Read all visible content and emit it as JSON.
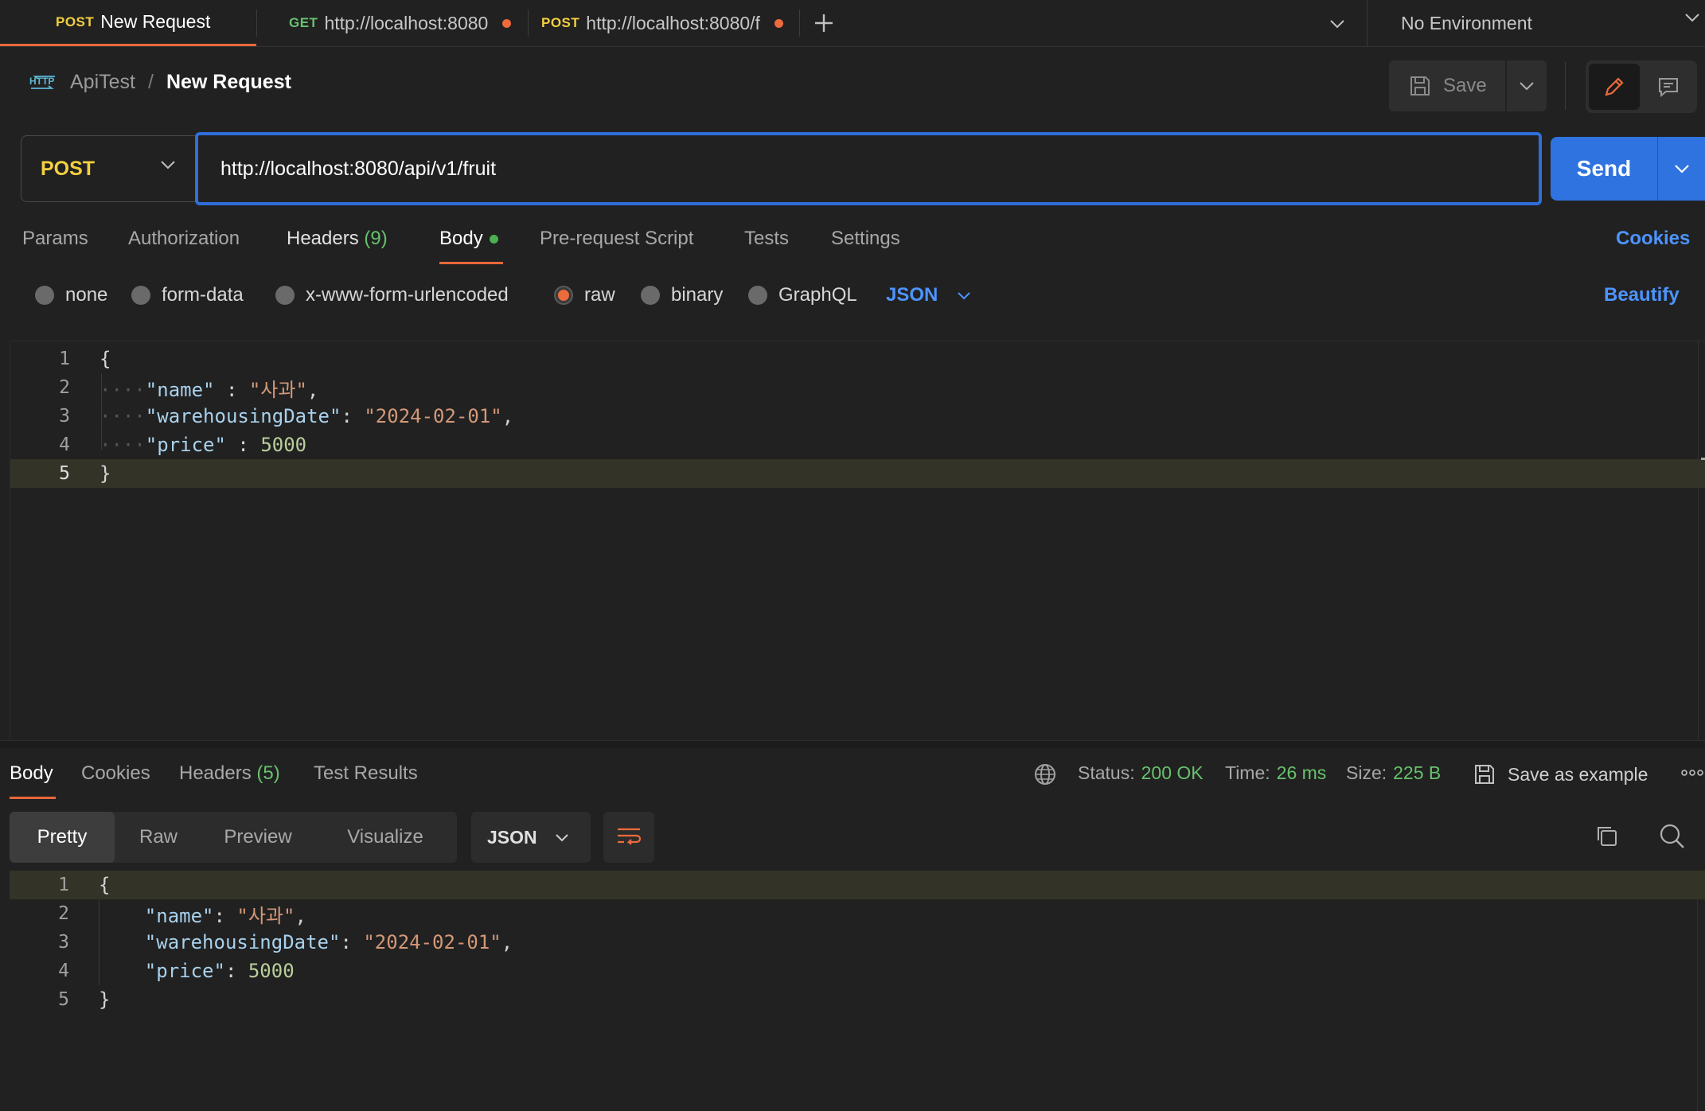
{
  "tabs": [
    {
      "method": "POST",
      "label": "New Request",
      "active": true,
      "unsaved": false
    },
    {
      "method": "GET",
      "label": "http://localhost:8080",
      "active": false,
      "unsaved": true
    },
    {
      "method": "POST",
      "label": "http://localhost:8080/f",
      "active": false,
      "unsaved": true
    }
  ],
  "environment": {
    "label": "No Environment"
  },
  "breadcrumb": {
    "collection": "ApiTest",
    "separator": "/",
    "request": "New Request"
  },
  "toolbar": {
    "save_label": "Save"
  },
  "request": {
    "method": "POST",
    "url": "http://localhost:8080/api/v1/fruit",
    "send_label": "Send"
  },
  "request_tabs": {
    "params": "Params",
    "authorization": "Authorization",
    "headers": "Headers",
    "headers_count": "(9)",
    "body": "Body",
    "prerequest": "Pre-request Script",
    "tests": "Tests",
    "settings": "Settings",
    "cookies": "Cookies"
  },
  "body_types": {
    "none": "none",
    "form_data": "form-data",
    "urlencoded": "x-www-form-urlencoded",
    "raw": "raw",
    "binary": "binary",
    "graphql": "GraphQL",
    "language": "JSON",
    "beautify": "Beautify",
    "selected": "raw"
  },
  "request_body": {
    "line_numbers": [
      "1",
      "2",
      "3",
      "4",
      "5"
    ],
    "open": "{",
    "close": "}",
    "fields": [
      {
        "key": "\"name\"",
        "sep": " : ",
        "value": "\"사과\"",
        "tail": ","
      },
      {
        "key": "\"warehousingDate\"",
        "sep": ": ",
        "value": "\"2024-02-01\"",
        "tail": ","
      },
      {
        "key": "\"price\"",
        "sep": " : ",
        "value": "5000",
        "tail": ""
      }
    ]
  },
  "response": {
    "tabs": {
      "body": "Body",
      "cookies": "Cookies",
      "headers": "Headers",
      "headers_count": "(5)",
      "test_results": "Test Results"
    },
    "status_label": "Status:",
    "status_value": "200 OK",
    "time_label": "Time:",
    "time_value": "26 ms",
    "size_label": "Size:",
    "size_value": "225 B",
    "save_example": "Save as example",
    "views": {
      "pretty": "Pretty",
      "raw": "Raw",
      "preview": "Preview",
      "visualize": "Visualize"
    },
    "format": "JSON",
    "line_numbers": [
      "1",
      "2",
      "3",
      "4",
      "5"
    ],
    "open": "{",
    "close": "}",
    "fields": [
      {
        "key": "\"name\"",
        "sep": ": ",
        "value": "\"사과\"",
        "tail": ","
      },
      {
        "key": "\"warehousingDate\"",
        "sep": ": ",
        "value": "\"2024-02-01\"",
        "tail": ","
      },
      {
        "key": "\"price\"",
        "sep": ": ",
        "value": "5000",
        "tail": ""
      }
    ]
  },
  "colors": {
    "accent": "#e8683a",
    "link": "#4d94ff",
    "send": "#2f73e0",
    "success": "#67c26e",
    "method_post": "#f4d03f",
    "method_get": "#67c26e"
  }
}
